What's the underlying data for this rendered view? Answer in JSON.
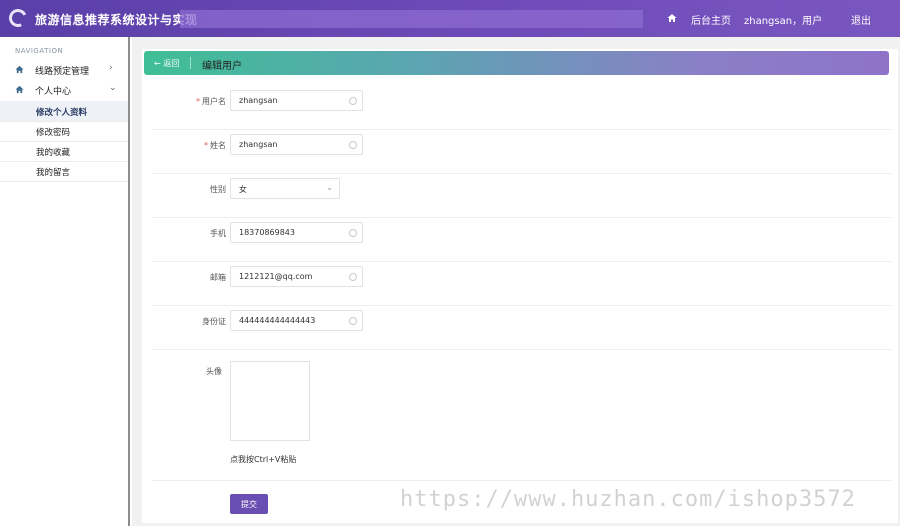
{
  "header": {
    "app_title": "旅游信息推荐系统设计与实现",
    "home_link": "后台主页",
    "user_label": "zhangsan，用户",
    "logout": "退出"
  },
  "sidebar": {
    "heading": "NAVIGATION",
    "groups": [
      {
        "label": "线路预定管理",
        "icon": "home-icon"
      },
      {
        "label": "个人中心",
        "icon": "home-icon"
      }
    ],
    "sub_items": [
      "修改个人资料",
      "修改密码",
      "我的收藏",
      "我的留言"
    ]
  },
  "banner": {
    "back": "← 返回",
    "title": "编辑用户"
  },
  "form": {
    "fields": [
      {
        "label": "用户名",
        "required": "*",
        "value": "zhangsan"
      },
      {
        "label": "姓名",
        "required": "*",
        "value": "zhangsan"
      },
      {
        "label": "性别",
        "value": "女"
      },
      {
        "label": "手机",
        "value": "18370869843"
      },
      {
        "label": "邮箱",
        "value": "1212121@qq.com"
      },
      {
        "label": "身份证",
        "value": "444444444444443"
      }
    ],
    "avatar_label": "头像",
    "paste_hint": "点我按Ctrl+V粘贴",
    "submit": "提交"
  },
  "watermark": "https://www.huzhan.com/ishop3572",
  "colors": {
    "header": "#6e4bb8",
    "accent": "#6a4fb3",
    "banner_start": "#3fbf95",
    "banner_end": "#8e73c9"
  }
}
